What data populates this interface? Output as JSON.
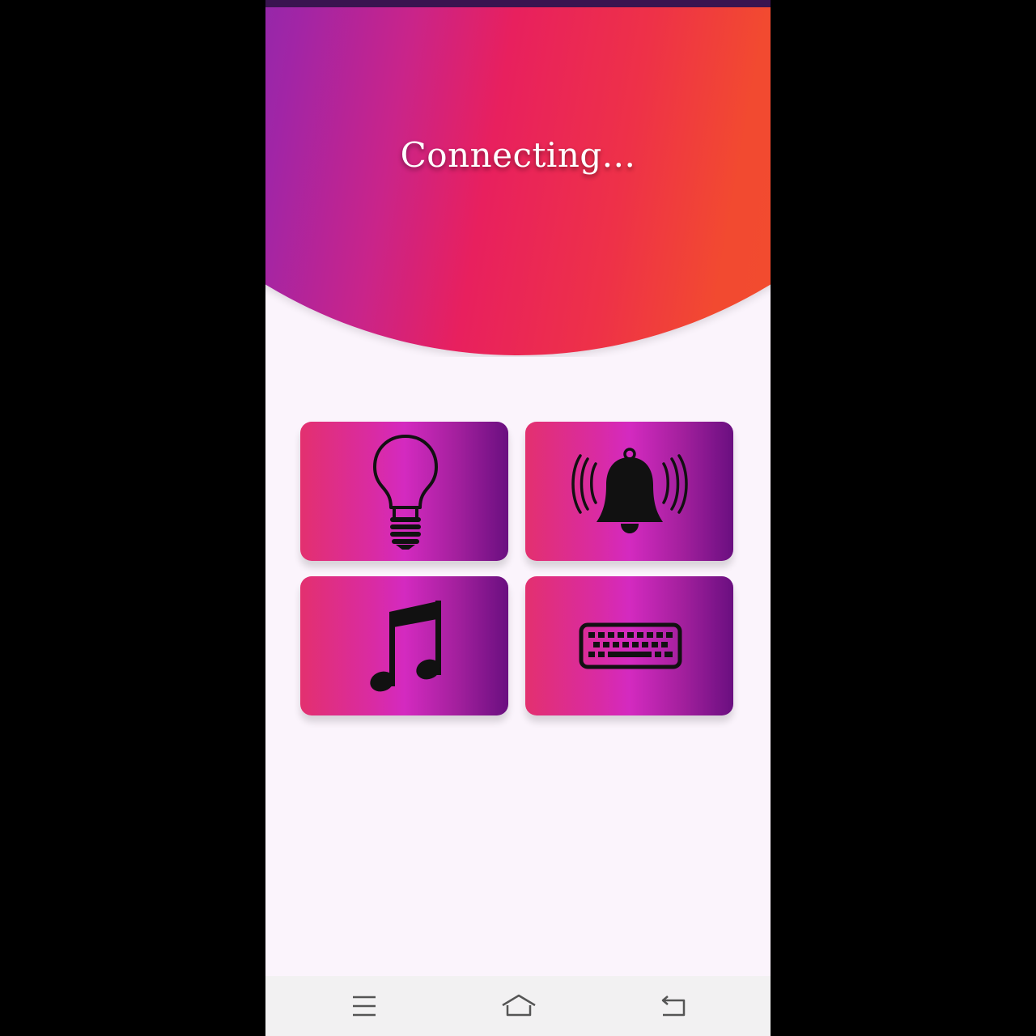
{
  "header": {
    "title": "Connecting..."
  },
  "tiles": [
    {
      "id": "light",
      "icon": "light-bulb-icon"
    },
    {
      "id": "bell",
      "icon": "ringing-bell-icon"
    },
    {
      "id": "music",
      "icon": "music-note-icon"
    },
    {
      "id": "keyboard",
      "icon": "keyboard-icon"
    }
  ],
  "nav": {
    "menu_icon": "menu-icon",
    "home_icon": "home-icon",
    "back_icon": "back-icon"
  },
  "colors": {
    "background": "#fbf4fc",
    "header_gradient": [
      "#6f2fb6",
      "#e8205e",
      "#f5502a"
    ],
    "tile_gradient": [
      "#e3306f",
      "#d42ac0",
      "#6a0f80"
    ],
    "status_bar": "#3a1450",
    "nav_bar": "#f2f1f2"
  }
}
